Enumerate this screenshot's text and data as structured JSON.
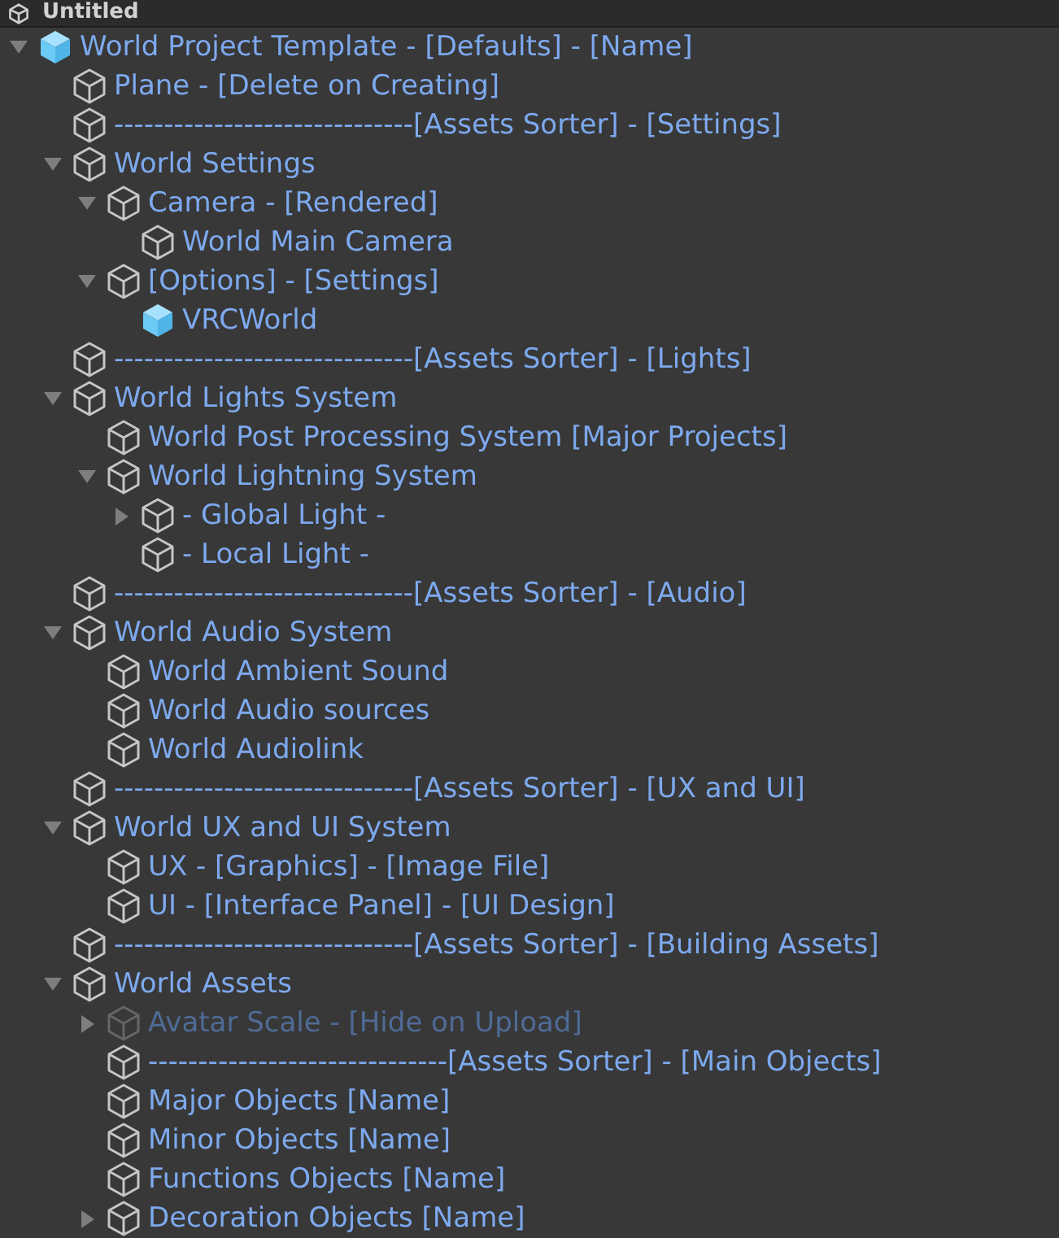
{
  "scene": {
    "title": "Untitled"
  },
  "hierarchy": {
    "items": [
      {
        "label": "World Project Template - [Defaults] - [Name]",
        "kind": "prefab_root",
        "expanded": true,
        "disabled": false,
        "children": [
          {
            "label": "Plane - [Delete on Creating]",
            "kind": "prefab",
            "disabled": false
          },
          {
            "label": "------------------------------[Assets Sorter] - [Settings]",
            "kind": "prefab",
            "disabled": false
          },
          {
            "label": "World Settings",
            "kind": "prefab",
            "expanded": true,
            "disabled": false,
            "children": [
              {
                "label": "Camera - [Rendered]",
                "kind": "prefab",
                "expanded": true,
                "disabled": false,
                "children": [
                  {
                    "label": "World Main Camera",
                    "kind": "prefab",
                    "disabled": false
                  }
                ]
              },
              {
                "label": "[Options] - [Settings]",
                "kind": "prefab",
                "expanded": true,
                "disabled": false,
                "children": [
                  {
                    "label": "VRCWorld",
                    "kind": "prefab_root",
                    "disabled": false
                  }
                ]
              }
            ]
          },
          {
            "label": "------------------------------[Assets Sorter] - [Lights]",
            "kind": "prefab",
            "disabled": false
          },
          {
            "label": "World Lights System",
            "kind": "prefab",
            "expanded": true,
            "disabled": false,
            "children": [
              {
                "label": "World Post Processing System [Major Projects]",
                "kind": "prefab",
                "disabled": false
              },
              {
                "label": "World Lightning System",
                "kind": "prefab",
                "expanded": true,
                "disabled": false,
                "children": [
                  {
                    "label": "- Global Light -",
                    "kind": "prefab",
                    "expanded": false,
                    "disabled": false
                  },
                  {
                    "label": "- Local Light -",
                    "kind": "prefab",
                    "disabled": false
                  }
                ]
              }
            ]
          },
          {
            "label": "------------------------------[Assets Sorter] - [Audio]",
            "kind": "prefab",
            "disabled": false
          },
          {
            "label": "World Audio System",
            "kind": "prefab",
            "expanded": true,
            "disabled": false,
            "children": [
              {
                "label": "World Ambient Sound",
                "kind": "prefab",
                "disabled": false
              },
              {
                "label": "World Audio sources",
                "kind": "prefab",
                "disabled": false
              },
              {
                "label": "World Audiolink",
                "kind": "prefab",
                "disabled": false
              }
            ]
          },
          {
            "label": "------------------------------[Assets Sorter] - [UX and UI]",
            "kind": "prefab",
            "disabled": false
          },
          {
            "label": "World UX and UI System",
            "kind": "prefab",
            "expanded": true,
            "disabled": false,
            "children": [
              {
                "label": "UX - [Graphics] - [Image File]",
                "kind": "prefab",
                "disabled": false
              },
              {
                "label": "UI - [Interface Panel] - [UI Design]",
                "kind": "prefab",
                "disabled": false
              }
            ]
          },
          {
            "label": "------------------------------[Assets Sorter] - [Building Assets]",
            "kind": "prefab",
            "disabled": false
          },
          {
            "label": "World Assets",
            "kind": "prefab",
            "expanded": true,
            "disabled": false,
            "children": [
              {
                "label": "Avatar Scale - [Hide on Upload]",
                "kind": "prefab",
                "expanded": false,
                "disabled": true
              },
              {
                "label": "------------------------------[Assets Sorter] - [Main Objects]",
                "kind": "prefab",
                "disabled": false
              },
              {
                "label": "Major Objects [Name]",
                "kind": "prefab",
                "disabled": false
              },
              {
                "label": "Minor Objects [Name]",
                "kind": "prefab",
                "disabled": false
              },
              {
                "label": "Functions Objects [Name]",
                "kind": "prefab",
                "disabled": false
              },
              {
                "label": "Decoration Objects [Name]",
                "kind": "prefab",
                "expanded": false,
                "disabled": false
              }
            ]
          }
        ]
      }
    ]
  }
}
